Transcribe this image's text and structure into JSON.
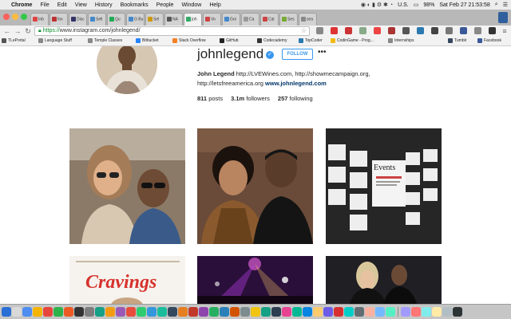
{
  "menubar": {
    "apple": "",
    "app_name": "Chrome",
    "items": [
      "File",
      "Edit",
      "View",
      "History",
      "Bookmarks",
      "People",
      "Window",
      "Help"
    ],
    "input_source": "U.S.",
    "battery": "98%",
    "clock": "Sat Feb 27  21:53:58"
  },
  "tabs": [
    {
      "label": "Inb",
      "color": "#d44"
    },
    {
      "label": "fox",
      "color": "#b33"
    },
    {
      "label": "Disc",
      "color": "#336"
    },
    {
      "label": "Sell",
      "color": "#48c"
    },
    {
      "label": "Qu",
      "color": "#2a5"
    },
    {
      "label": "G Bu",
      "color": "#48c"
    },
    {
      "label": "Sel",
      "color": "#c90"
    },
    {
      "label": "NA",
      "color": "#555"
    },
    {
      "label": "joh",
      "color": "#3a6",
      "active": true
    },
    {
      "label": "Vo",
      "color": "#c44"
    },
    {
      "label": "Goi",
      "color": "#48c"
    },
    {
      "label": "Ca",
      "color": "#999"
    },
    {
      "label": "Cal",
      "color": "#c44"
    },
    {
      "label": "Ses",
      "color": "#7a3"
    },
    {
      "label": "sea",
      "color": "#888"
    }
  ],
  "toolbar": {
    "back": "←",
    "forward": "→",
    "reload": "↻",
    "url_scheme": "https://",
    "url_rest": "www.instagram.com/johnlegend/",
    "star": "☆"
  },
  "bookmarks": [
    {
      "label": "TLePortal",
      "color": "#555"
    },
    {
      "label": "Language Stuff",
      "color": "#888"
    },
    {
      "label": "Temple Classes",
      "color": "#888"
    },
    {
      "label": "Bitbucket",
      "color": "#2684ff"
    },
    {
      "label": "Stack Overflow",
      "color": "#f48024"
    },
    {
      "label": "GitHub",
      "color": "#222"
    },
    {
      "label": "Codecademy",
      "color": "#333"
    },
    {
      "label": "TopCoder",
      "color": "#2a7ab0"
    },
    {
      "label": "CodinGame - Prog...",
      "color": "#f2bb13"
    },
    {
      "label": "Internships",
      "color": "#888"
    },
    {
      "label": "Tumblr",
      "color": "#36465d"
    },
    {
      "label": "Facebook",
      "color": "#3b5998"
    }
  ],
  "profile": {
    "username": "johnlegend",
    "verified_icon": "✓",
    "follow_label": "FOLLOW",
    "more_label": "•••",
    "bio_name": "John Legend",
    "bio_text": " http://LVEWines.com, http://showmecampaign.org,",
    "bio_line2": "http://letsfreeamerica.org ",
    "bio_link": "www.johnlegend.com",
    "posts_count": "811",
    "posts_label": " posts",
    "followers_count": "3.1m",
    "followers_label": " followers",
    "following_count": "257",
    "following_label": " following"
  },
  "photos": [
    {
      "name": "photo-selfie-couple-car"
    },
    {
      "name": "photo-selfie-fan"
    },
    {
      "name": "photo-events-board"
    },
    {
      "name": "photo-cravings-book"
    },
    {
      "name": "photo-concert-stage"
    },
    {
      "name": "photo-couple-event"
    }
  ],
  "photo_caption_book": "Cravings",
  "photo_caption_events": "Events",
  "dock": {
    "icons": [
      "#2a6fd6",
      "#d9d9d9",
      "#4d8ef0",
      "#f5b400",
      "#e8453c",
      "#2db34a",
      "#ee5a24",
      "#333",
      "#7d7d7d",
      "#16a085",
      "#f39c12",
      "#9b59b6",
      "#e74c3c",
      "#2ecc71",
      "#3498db",
      "#1abc9c",
      "#34495e",
      "#e67e22",
      "#c0392b",
      "#8e44ad",
      "#27ae60",
      "#2980b9",
      "#d35400",
      "#7f8c8d",
      "#f1c40f",
      "#16a085",
      "#2c3e50",
      "#e84393",
      "#00b894",
      "#0984e3",
      "#fdcb6e",
      "#6c5ce7",
      "#d63031",
      "#00cec9",
      "#636e72",
      "#fab1a0",
      "#74b9ff",
      "#55efc4",
      "#a29bfe",
      "#ff7675",
      "#81ecec",
      "#ffeaa7",
      "#b2bec3",
      "#2d3436"
    ]
  }
}
